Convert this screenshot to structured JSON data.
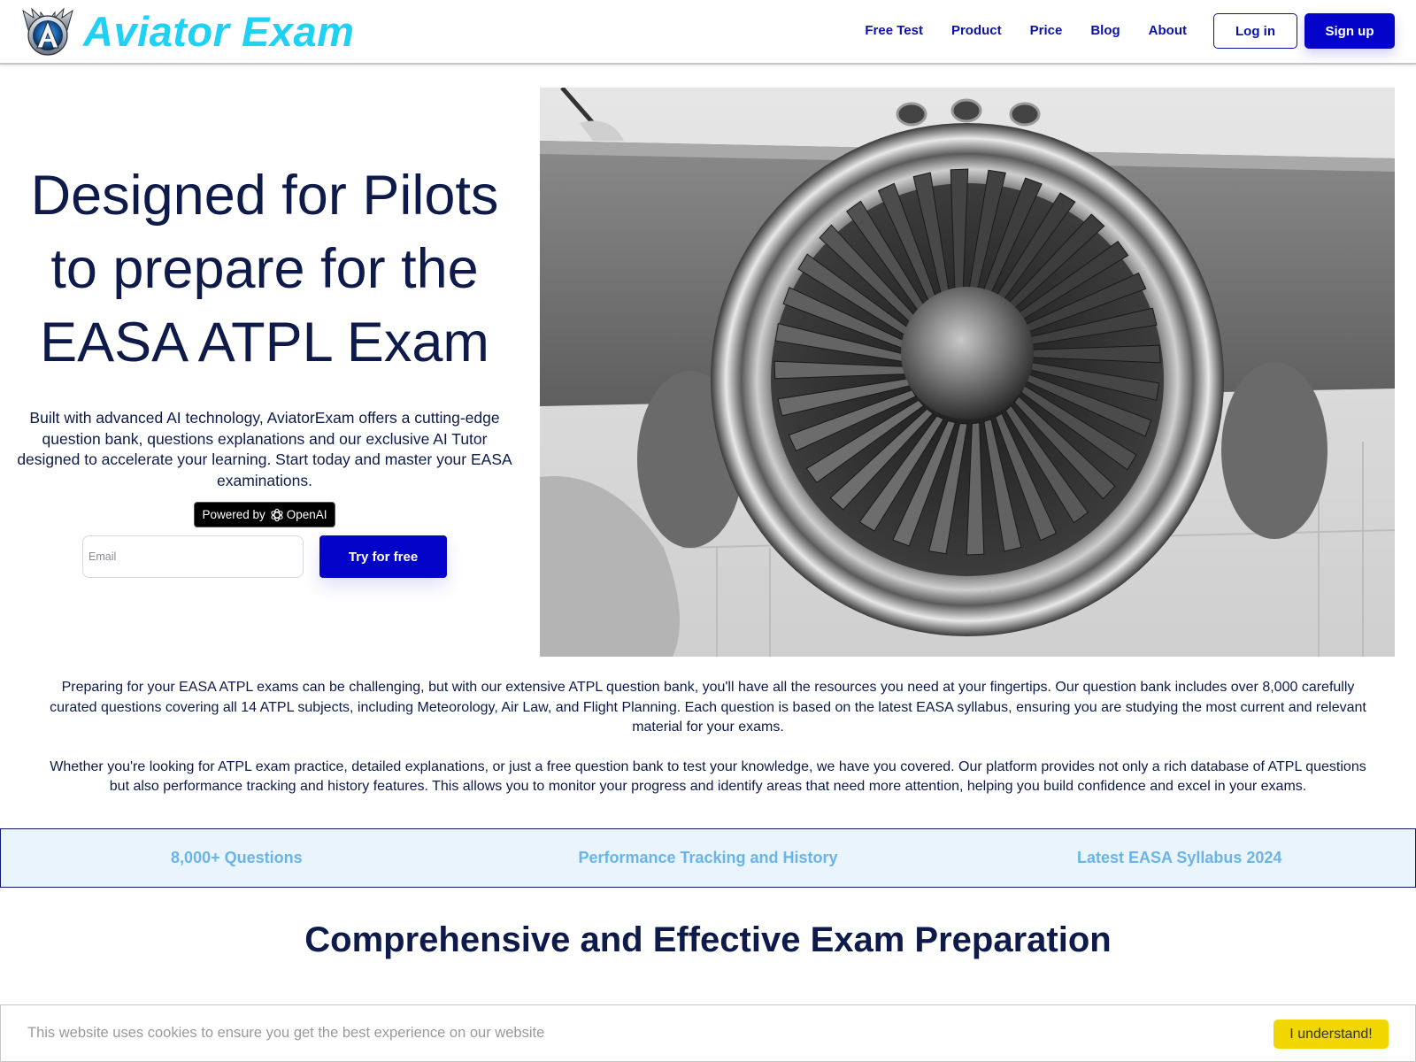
{
  "header": {
    "brand_name": "Aviator Exam",
    "brand_color": "#1fd1f5",
    "logo_icon": "winged-a-emblem-icon",
    "nav": [
      {
        "label": "Free Test"
      },
      {
        "label": "Product"
      },
      {
        "label": "Price"
      },
      {
        "label": "Blog"
      },
      {
        "label": "About"
      }
    ],
    "login_label": "Log in",
    "signup_label": "Sign up",
    "accent_color": "#0303c9"
  },
  "hero": {
    "title_lines": [
      "Designed for Pilots",
      "to prepare for the",
      "EASA ATPL Exam"
    ],
    "description": "Built with advanced AI technology, AviatorExam offers a cutting-edge question bank, questions explanations and our exclusive AI Tutor designed to accelerate your learning. Start today and master your EASA examinations.",
    "badge": {
      "prefix": "Powered by",
      "icon": "openai-logo-icon",
      "brand": "OpenAI"
    },
    "email_placeholder": "Email",
    "email_value": "",
    "cta_label": "Try for free",
    "image_alt": "jet-engine-photo"
  },
  "intro": {
    "paragraphs": [
      "Preparing for your EASA ATPL exams can be challenging, but with our extensive ATPL question bank, you'll have all the resources you need at your fingertips. Our question bank includes over 8,000 carefully curated questions covering all 14 ATPL subjects, including Meteorology, Air Law, and Flight Planning. Each question is based on the latest EASA syllabus, ensuring you are studying the most current and relevant material for your exams.",
      "Whether you're looking for ATPL exam practice, detailed explanations, or just a free question bank to test your knowledge, we have you covered. Our platform provides not only a rich database of ATPL questions but also performance tracking and history features. This allows you to monitor your progress and identify areas that need more attention, helping you build confidence and excel in your exams."
    ]
  },
  "features": [
    {
      "label": "8,000+ Questions"
    },
    {
      "label": "Performance Tracking and History"
    },
    {
      "label": "Latest EASA Syllabus 2024"
    }
  ],
  "section": {
    "title": "Comprehensive and Effective Exam Preparation"
  },
  "cookie": {
    "message": "This website uses cookies to ensure you get the best experience on our website",
    "button_label": "I understand!",
    "button_color": "#f1d600"
  }
}
